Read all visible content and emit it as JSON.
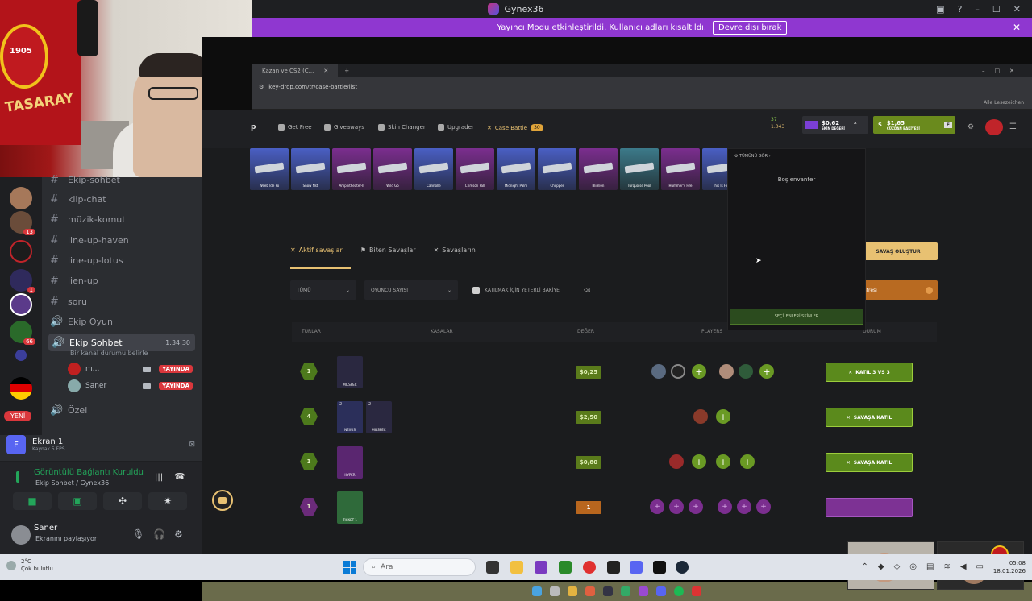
{
  "window": {
    "title": "Gynex36"
  },
  "banner": {
    "text": "Yayıncı Modu etkinleştirildi. Kullanıcı adları kısaltıldı.",
    "button": "Devre dışı bırak"
  },
  "webcam": {
    "badge": "1905",
    "flag_text": "TASARAY"
  },
  "discord": {
    "channels": [
      {
        "icon": "hash",
        "label": "Ekip-sohbet"
      },
      {
        "icon": "hash",
        "label": "klip-chat"
      },
      {
        "icon": "hash",
        "label": "müzik-komut"
      },
      {
        "icon": "hash",
        "label": "line-up-haven"
      },
      {
        "icon": "hash",
        "label": "line-up-lotus"
      },
      {
        "icon": "hash",
        "label": "lien-up"
      },
      {
        "icon": "hash",
        "label": "soru"
      },
      {
        "icon": "speaker",
        "label": "Ekip Oyun"
      },
      {
        "icon": "speaker",
        "label": "Ekip Sohbet",
        "time": "1:34:30",
        "status": "Bir kanal durumu belirle"
      },
      {
        "icon": "speaker",
        "label": "Özel"
      }
    ],
    "voice_users": [
      {
        "name": "m...",
        "badge": "YAYINDA"
      },
      {
        "name": "Saner",
        "badge": "YAYINDA"
      }
    ],
    "guild_badges": [
      "13",
      "1",
      "66"
    ],
    "new_label": "YENİ",
    "screen_share": {
      "initial": "F",
      "title": "Ekran 1",
      "sub": "Kaynak 5 FPS"
    },
    "voice_panel": {
      "title": "Görüntülü Bağlantı Kuruldu",
      "sub": "Ekip Sohbet / Gynex36"
    },
    "user": {
      "name": "Saner",
      "status": "Ekranını paylaşıyor"
    }
  },
  "browser": {
    "tab": "Kazan ve CS2 (C...",
    "url": "key-drop.com/tr/case-battle/list",
    "bookmarks": "Alle Lesezeichen"
  },
  "site": {
    "nav": [
      "Get Free",
      "Giveaways",
      "Skin Changer",
      "Upgrader",
      "Case Battle"
    ],
    "case_battle_count": "30",
    "counts": [
      "37",
      "1.043"
    ],
    "skin_value": {
      "amount": "$0,62",
      "label": "SKİN DEĞERİ"
    },
    "balance": {
      "amount": "$1,65",
      "label": "CÜZDAN BAKİYESİ"
    },
    "ticker": [
      {
        "label": "Weeb Ide Fo",
        "color": "#4a5fc4"
      },
      {
        "label": "Snow Nst",
        "color": "#4a5fc4"
      },
      {
        "label": "Amphitheater-II",
        "color": "#7b2e8f"
      },
      {
        "label": "Wild Go",
        "color": "#7b2e8f"
      },
      {
        "label": "Cannolle",
        "color": "#4a5fc4"
      },
      {
        "label": "Crimson Fall",
        "color": "#7b2e8f"
      },
      {
        "label": "Midnight Palm",
        "color": "#4a5fc4"
      },
      {
        "label": "Chopper",
        "color": "#4a5fc4"
      },
      {
        "label": "Blimlen",
        "color": "#7b2e8f"
      },
      {
        "label": "Turquoise Pool",
        "color": "#3c7a8a"
      },
      {
        "label": "Hummer's Fire",
        "color": "#7b2e8f"
      },
      {
        "label": "This Is Fine",
        "color": "#4a5fc4"
      },
      {
        "label": "TV On Mirage",
        "color": "#4a5fc4"
      }
    ],
    "tabs": [
      "Aktif savaşlar",
      "Biten Savaşlar",
      "Savaşların"
    ],
    "create_button": "SAVAŞ OLUŞTUR",
    "orange_button": "atresi",
    "filters": {
      "all": "TÜMÜ",
      "players": "OYUNCU SAYISI",
      "checkbox": "KATILMAK İÇİN YETERLİ BAKİYE"
    },
    "headers": [
      "TURLAR",
      "KASALAR",
      "DEĞER",
      "PLAYERS",
      "DURUM"
    ],
    "rows": [
      {
        "round": "1",
        "cases": [
          {
            "label": "MILSPEC",
            "count": ""
          }
        ],
        "price": "$0,25",
        "join": "KATIL 3 VS 3",
        "style": "green"
      },
      {
        "round": "4",
        "cases": [
          {
            "label": "NEXUS",
            "count": "2"
          },
          {
            "label": "MILSPEC",
            "count": "2"
          }
        ],
        "price": "$2,50",
        "join": "SAVAŞA KATIL",
        "style": "green"
      },
      {
        "round": "1",
        "cases": [
          {
            "label": "HYPER",
            "count": ""
          }
        ],
        "price": "$0,80",
        "join": "SAVAŞA KATIL",
        "style": "green"
      },
      {
        "round": "1",
        "cases": [
          {
            "label": "TICKET 1",
            "count": ""
          }
        ],
        "price": "1",
        "join": "",
        "style": "purple"
      }
    ],
    "inventory": {
      "header": "TÜMÜNÜ GÖR",
      "empty": "Boş envanter",
      "select": "SEÇİLENLERİ SKİNLER"
    }
  },
  "taskbar": {
    "weather_temp": "2°C",
    "weather_desc": "Çok bulutlu",
    "search": "Ara",
    "time": "05:08",
    "date": "18.01.2026"
  }
}
